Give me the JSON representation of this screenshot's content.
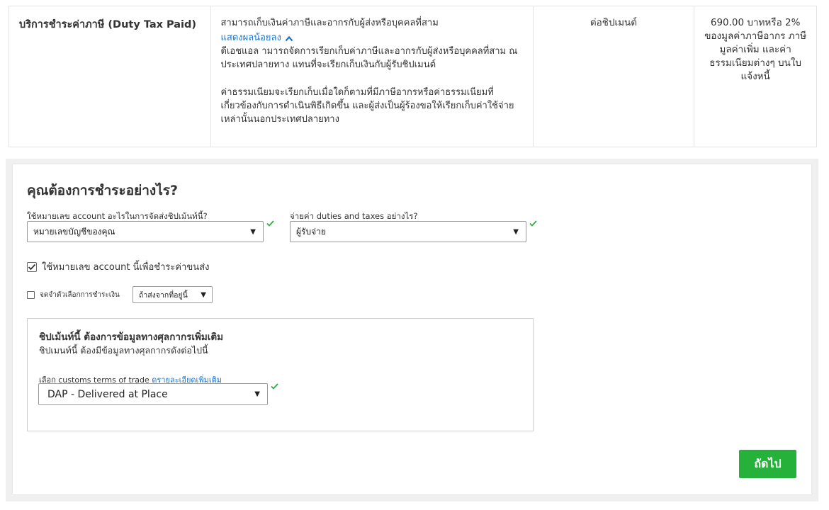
{
  "service_row": {
    "name": "บริการชำระค่าภาษี (Duty Tax Paid)",
    "description_intro": "สามารถเก็บเงินค่าภาษีและอากรกับผู้ส่งหรือบุคคลที่สาม",
    "show_less_link": "แสดงผลน้อยลง",
    "description_para1": "ดีเอชแอล ามารถจัดการเรียกเก็บค่าภาษีและอากรกับผู้ส่งหรือบุคคลที่สาม ณ ประเทศปลายทาง แทนที่จะเรียกเก็บเงินกับผู้รับชิปเมนต์",
    "description_para2": "ค่าธรรมเนียมจะเรียกเก็บเมื่อใดก็ตามที่มีภาษีอากรหรือค่าธรรมเนียมที่เกี่ยวข้องกับการดำเนินพิธีเกิดขึ้น และผู้ส่งเป็นผู้ร้องขอให้เรียกเก็บค่าใช้จ่ายเหล่านั้นนอกประเทศปลายทาง",
    "unit": "ต่อชิปเมนต์",
    "price": "690.00 บาทหรือ 2% ของมูลค่าภาษีอากร ภาษีมูลค่าเพิ่ม และค่าธรรมเนียมต่างๆ บนใบแจ้งหนี้"
  },
  "payment": {
    "title": "คุณต้องการชำระอย่างไร?",
    "account_label": "ใช้หมายเลข account อะไรในการจัดส่งชิปเม้นท์นี้?",
    "account_value": "หมายเลขบัญชีของคุณ",
    "duties_label": "จ่ายค่า duties and taxes อย่างไร?",
    "duties_value": "ผู้รับจ่าย",
    "use_account_checkbox": "ใช้หมายเลข account นี้เพื่อชำระค่าขนส่ง",
    "remember_checkbox": "จดจำตัวเลือกการชำระเงิน",
    "remember_option": "ถ้าส่งจากที่อยู่นี้"
  },
  "customs": {
    "title": "ชิปเม้นท์นี้ ต้องการข้อมูลทางศุลกากรเพิ่มเติม",
    "subtitle": "ชิปเมนท์นี้ ต้องมีข้อมูลทางศุลกากรดังต่อไปนี้",
    "terms_label": "เลือก customs terms of trade",
    "details_link": "ดูรายละเอียดเพิ่มเติม",
    "terms_value": "DAP - Delivered at Place"
  },
  "next_button": "ถัดไป",
  "colors": {
    "accent_green": "#26b13a",
    "link_blue": "#1a73c8",
    "check_green": "#2eaa3c"
  },
  "icons": [
    "chevron-up-icon",
    "dropdown-caret-icon",
    "checkmark-icon"
  ]
}
